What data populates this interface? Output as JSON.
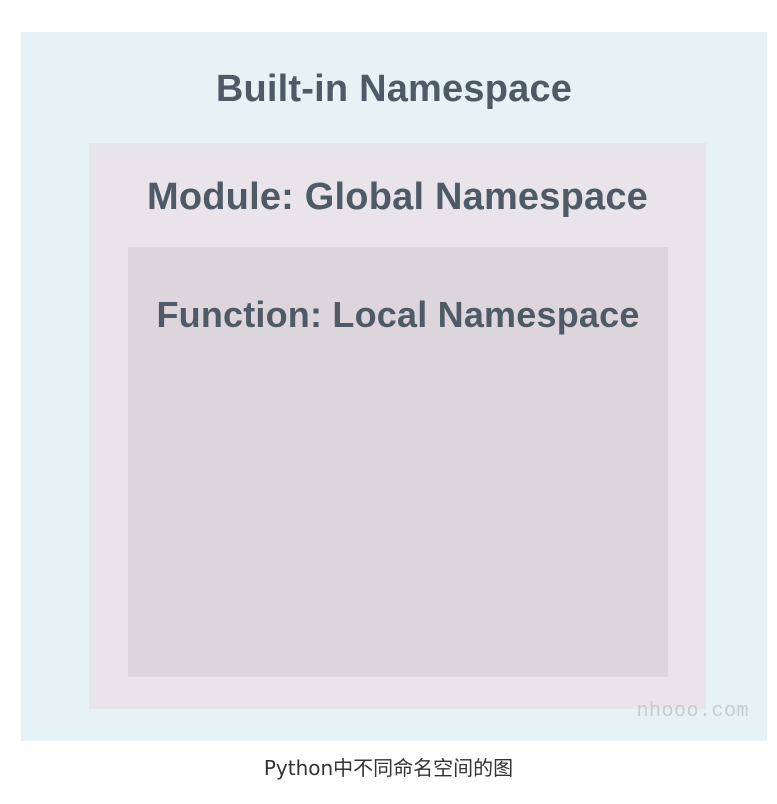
{
  "diagram": {
    "outer_box": {
      "label": "Built-in Namespace",
      "color": "#e7f2f7"
    },
    "middle_box": {
      "label": "Module: Global Namespace",
      "color": "#e9e4ea"
    },
    "inner_box": {
      "label": "Function: Local Namespace",
      "color": "#dcd5dc"
    },
    "text_color": "#4e5b66",
    "watermark": "nhooo.com"
  },
  "caption": "Python中不同命名空间的图"
}
